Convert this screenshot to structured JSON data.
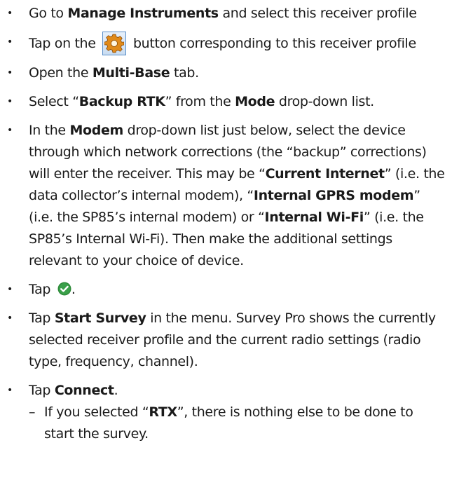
{
  "bullet": "•",
  "dash": "–",
  "steps": [
    {
      "a": "Go to ",
      "b": "Manage Instruments",
      "c": " and select this receiver profile"
    },
    {
      "a": "Tap on the ",
      "c": " button corresponding to this receiver profile"
    },
    {
      "a": "Open the ",
      "b": "Multi-Base",
      "c": " tab."
    },
    {
      "a": "Select “",
      "b": "Backup RTK",
      "c": "” from the ",
      "d": "Mode",
      "e": " drop-down list."
    },
    {
      "a": "In the ",
      "b": "Modem",
      "c": " drop-down list just below, select the device through which network corrections (the “backup” corrections) will enter the receiver. This may be “",
      "d": "Current Internet",
      "e": "” (i.e. the data collector’s internal modem), “",
      "f": "Internal GPRS modem",
      "g": "” (i.e. the SP85’s internal modem) or “",
      "h": "Internal Wi-Fi",
      "i": "” (i.e. the SP85’s Internal Wi-Fi). Then make the additional settings relevant to your choice of device."
    },
    {
      "a": "Tap ",
      "c": "."
    },
    {
      "a": "Tap ",
      "b": "Start Survey",
      "c": " in the menu. Survey Pro shows the currently selected receiver profile and the current radio settings (radio type, frequency, channel)."
    },
    {
      "a": "Tap ",
      "b": "Connect",
      "c": ".",
      "sub": [
        {
          "a": "If you selected “",
          "b": "RTX",
          "c": "”, there is nothing else to be done to start the survey."
        }
      ]
    }
  ],
  "icons": {
    "gear": "gear-icon",
    "check": "check-circle-icon"
  },
  "colors": {
    "gear_orange": "#e08a1a",
    "check_green": "#2e8b3a"
  }
}
